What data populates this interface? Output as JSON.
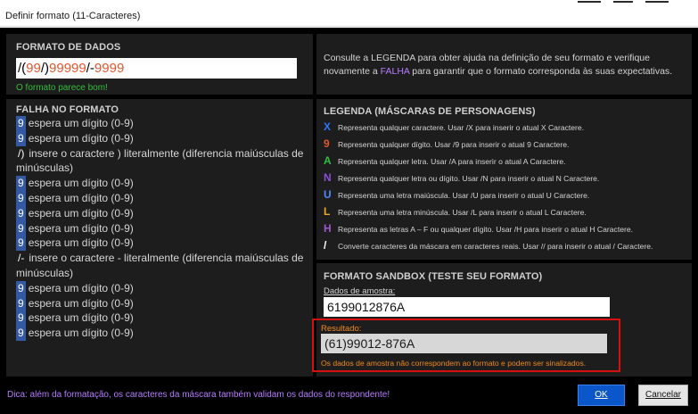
{
  "window": {
    "title": "Definir formato (11-Caracteres)"
  },
  "format_panel": {
    "title": "FORMATO DE DADOS",
    "tokens": [
      {
        "text": "/(",
        "role": "sym"
      },
      {
        "text": "99",
        "role": "other"
      },
      {
        "text": "/)",
        "role": "sym"
      },
      {
        "text": "99999",
        "role": "other"
      },
      {
        "text": "/-",
        "role": "sym"
      },
      {
        "text": "9999",
        "role": "other"
      }
    ],
    "status": "O formato parece bom!"
  },
  "info_panel": {
    "text_before": "Consulte a LEGENDA para obter ajuda na definição de seu formato e verifique novamente a ",
    "highlight": "FALHA",
    "text_after": " para garantir que o formato corresponda às suas expectativas."
  },
  "fail_panel": {
    "title": "FALHA NO FORMATO",
    "rows": [
      {
        "token": "9",
        "kind": "digit",
        "text": "espera um dígito (0-9)"
      },
      {
        "token": "9",
        "kind": "digit",
        "text": "espera um dígito (0-9)"
      },
      {
        "token": "/)",
        "kind": "literal",
        "text": "insere o caractere ) literalmente (diferencia maiúsculas de minúsculas)"
      },
      {
        "token": "9",
        "kind": "digit",
        "text": "espera um dígito (0-9)"
      },
      {
        "token": "9",
        "kind": "digit",
        "text": "espera um dígito (0-9)"
      },
      {
        "token": "9",
        "kind": "digit",
        "text": "espera um dígito (0-9)"
      },
      {
        "token": "9",
        "kind": "digit",
        "text": "espera um dígito (0-9)"
      },
      {
        "token": "9",
        "kind": "digit",
        "text": "espera um dígito (0-9)"
      },
      {
        "token": "/-",
        "kind": "literal",
        "text": "insere o caractere - literalmente (diferencia maiúsculas de minúsculas)"
      },
      {
        "token": "9",
        "kind": "digit",
        "text": "espera um dígito (0-9)"
      },
      {
        "token": "9",
        "kind": "digit",
        "text": "espera um dígito (0-9)"
      },
      {
        "token": "9",
        "kind": "digit",
        "text": "espera um dígito (0-9)"
      },
      {
        "token": "9",
        "kind": "digit",
        "text": "espera um dígito (0-9)"
      }
    ]
  },
  "legend_panel": {
    "title": "LEGENDA (MÁSCARAS DE PERSONAGENS)",
    "items": [
      {
        "char": "X",
        "color": "#2f74ff",
        "text": "Representa qualquer caractere. Usar /X para inserir o atual X Caractere."
      },
      {
        "char": "9",
        "color": "#e2572f",
        "text": "Representa qualquer dígito. Usar /9 para inserir o atual 9 Caractere."
      },
      {
        "char": "A",
        "color": "#2fbf3a",
        "text": "Representa qualquer letra. Usar /A para inserir o atual A Caractere."
      },
      {
        "char": "N",
        "color": "#8a4fd6",
        "text": "Representa qualquer letra ou dígito. Usar /N para inserir o atual N Caractere."
      },
      {
        "char": "U",
        "color": "#4d8dff",
        "text": "Representa uma letra maiúscula. Usar /U para inserir o atual U Caractere."
      },
      {
        "char": "L",
        "color": "#f0a51e",
        "text": "Representa uma letra minúscula. Usar /L para inserir o atual L Caractere."
      },
      {
        "char": "H",
        "color": "#9b59c9",
        "text": "Representa as letras A – F ou qualquer dígito. Usar /H para inserir o atual H Caractere."
      },
      {
        "char": "/",
        "color": "#ffffff",
        "text": "Converte caracteres da máscara em caracteres reais. Usar // para inserir o atual / Caractere."
      }
    ]
  },
  "sandbox_panel": {
    "title": "FORMATO SANDBOX (TESTE SEU FORMATO)",
    "sample_label": "Dados de amostra:",
    "sample_value": "6199012876A",
    "result_label": "Resultado:",
    "result_value": "(61)99012-876A",
    "warning": "Os dados de amostra não correspondem ao formato e podem ser sinalizados."
  },
  "footer": {
    "tip": "Dica: além da formatação, os caracteres da máscara também validam os dados do respondente!",
    "ok_label": "OK",
    "cancel_label": "Cancelar"
  }
}
